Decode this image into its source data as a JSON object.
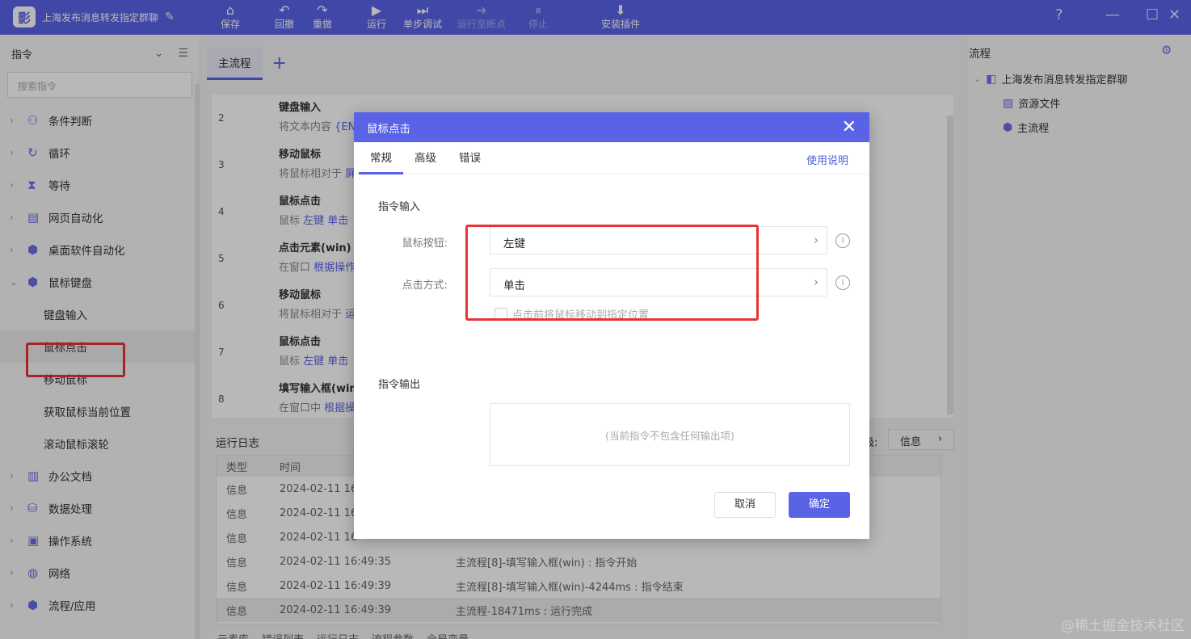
{
  "app": {
    "title": "上海发布消息转发指定群聊",
    "logo_text": "影"
  },
  "toolbar": [
    {
      "label": "保存",
      "icon": "⌂",
      "disabled": false
    },
    {
      "label": "回撤",
      "icon": "↶",
      "disabled": false
    },
    {
      "label": "重做",
      "icon": "↷",
      "disabled": false
    },
    {
      "label": "运行",
      "icon": "▶",
      "disabled": false
    },
    {
      "label": "单步调试",
      "icon": "⏭",
      "disabled": false
    },
    {
      "label": "运行至断点",
      "icon": "➜",
      "disabled": true
    },
    {
      "label": "停止",
      "icon": "⏸",
      "disabled": true
    },
    {
      "label": "安装插件",
      "icon": "⬇",
      "disabled": false
    }
  ],
  "window": {
    "help": "?",
    "minimize": "—",
    "maximize": "☐",
    "close": "✕"
  },
  "left": {
    "title": "指令",
    "search_placeholder": "搜索指令",
    "items": [
      {
        "label": "条件判断",
        "icon": "⚇"
      },
      {
        "label": "循环",
        "icon": "↻"
      },
      {
        "label": "等待",
        "icon": "⧗"
      },
      {
        "label": "网页自动化",
        "icon": "▤"
      },
      {
        "label": "桌面软件自动化",
        "icon": "⬢"
      },
      {
        "label": "鼠标键盘",
        "icon": "⬢"
      }
    ],
    "sub_items": [
      "键盘输入",
      "鼠标点击",
      "移动鼠标",
      "获取鼠标当前位置",
      "滚动鼠标滚轮"
    ],
    "items_after": [
      {
        "label": "办公文档",
        "icon": "▥"
      },
      {
        "label": "数据处理",
        "icon": "⛁"
      },
      {
        "label": "操作系统",
        "icon": "▣"
      },
      {
        "label": "网络",
        "icon": "◍"
      },
      {
        "label": "流程/应用",
        "icon": "⬢"
      }
    ]
  },
  "main": {
    "tab": "主流程",
    "add": "+",
    "rows": [
      {
        "num": "2",
        "name": "键盘输入",
        "desc": "将文本内容",
        "hl": "{EN"
      },
      {
        "num": "3",
        "name": "移动鼠标",
        "desc": "将鼠标相对于",
        "hl": "屏"
      },
      {
        "num": "4",
        "name": "鼠标点击",
        "desc": "鼠标",
        "hl": "左键 单击"
      },
      {
        "num": "5",
        "name": "点击元素(win)",
        "desc": "在窗口",
        "hl": "根据操作"
      },
      {
        "num": "6",
        "name": "移动鼠标",
        "desc": "将鼠标相对于",
        "hl": "运"
      },
      {
        "num": "7",
        "name": "鼠标点击",
        "desc": "鼠标",
        "hl": "左键 单击"
      },
      {
        "num": "8",
        "name": "填写输入框(win",
        "desc": "在窗口中",
        "hl": "根据操"
      }
    ]
  },
  "log": {
    "title": "运行日志",
    "level_label": "级:",
    "level": "信息",
    "headers": [
      "类型",
      "时间",
      ""
    ],
    "rows": [
      [
        "信息",
        "2024-02-11 16",
        ""
      ],
      [
        "信息",
        "2024-02-11 16",
        ""
      ],
      [
        "信息",
        "2024-02-11 16",
        ""
      ],
      [
        "信息",
        "2024-02-11 16:49:35",
        "主流程[8]-填写输入框(win) : 指令开始"
      ],
      [
        "信息",
        "2024-02-11 16:49:39",
        "主流程[8]-填写输入框(win)-4244ms : 指令结束"
      ],
      [
        "信息",
        "2024-02-11 16:49:39",
        "主流程-18471ms : 运行完成"
      ]
    ],
    "bottom_tabs": [
      "元素库",
      "错误列表",
      "运行日志",
      "流程参数",
      "全局变量"
    ]
  },
  "right": {
    "title": "流程",
    "tree_root": "上海发布消息转发指定群聊",
    "children": [
      "资源文件",
      "主流程"
    ]
  },
  "dialog": {
    "title": "鼠标点击",
    "tabs": [
      "常规",
      "高级",
      "错误"
    ],
    "help_link": "使用说明",
    "input_section": "指令输入",
    "fields": [
      {
        "label": "鼠标按钮:",
        "value": "左键"
      },
      {
        "label": "点击方式:",
        "value": "单击"
      }
    ],
    "checkbox_label": "点击前将鼠标移动到指定位置",
    "output_section": "指令输出",
    "output_empty": "(当前指令不包含任何输出项)",
    "cancel": "取消",
    "ok": "确定"
  },
  "watermark": "@稀土掘金技术社区",
  "colors": {
    "accent": "#5a63e6",
    "highlight": "#e63333"
  }
}
